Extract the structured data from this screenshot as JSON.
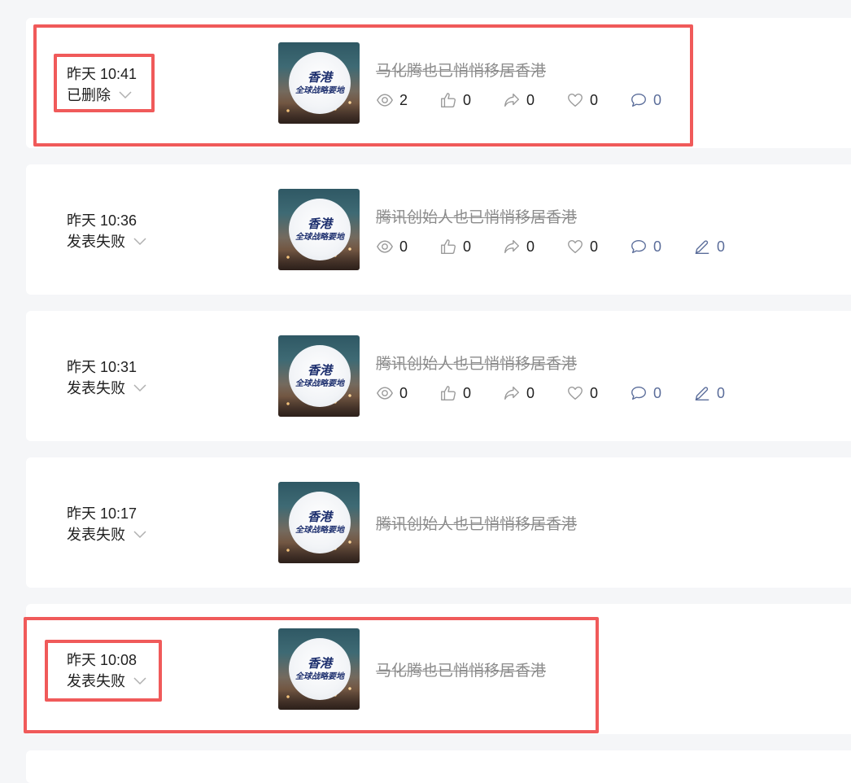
{
  "thumbnail": {
    "line1": "香港",
    "line2": "全球战略要地"
  },
  "posts": [
    {
      "time": "昨天 10:41",
      "status": "已删除",
      "title": "马化腾也已悄悄移居香港",
      "stats": {
        "views": "2",
        "likes": "0",
        "shares": "0",
        "favorites": "0",
        "comments": "0"
      }
    },
    {
      "time": "昨天 10:36",
      "status": "发表失败",
      "title": "腾讯创始人也已悄悄移居香港",
      "stats": {
        "views": "0",
        "likes": "0",
        "shares": "0",
        "favorites": "0",
        "comments": "0",
        "edits": "0"
      }
    },
    {
      "time": "昨天 10:31",
      "status": "发表失败",
      "title": "腾讯创始人也已悄悄移居香港",
      "stats": {
        "views": "0",
        "likes": "0",
        "shares": "0",
        "favorites": "0",
        "comments": "0",
        "edits": "0"
      }
    },
    {
      "time": "昨天 10:17",
      "status": "发表失败",
      "title": "腾讯创始人也已悄悄移居香港"
    },
    {
      "time": "昨天 10:08",
      "status": "发表失败",
      "title": "马化腾也已悄悄移居香港"
    }
  ],
  "colors": {
    "highlight": "#f05a5a",
    "stat_blue": "#5b6d9a",
    "title_gray": "#8b8b8b"
  },
  "icons": [
    "eye-icon",
    "thumbs-up-icon",
    "share-icon",
    "heart-icon",
    "comment-icon",
    "pencil-icon",
    "chevron-down-icon"
  ]
}
